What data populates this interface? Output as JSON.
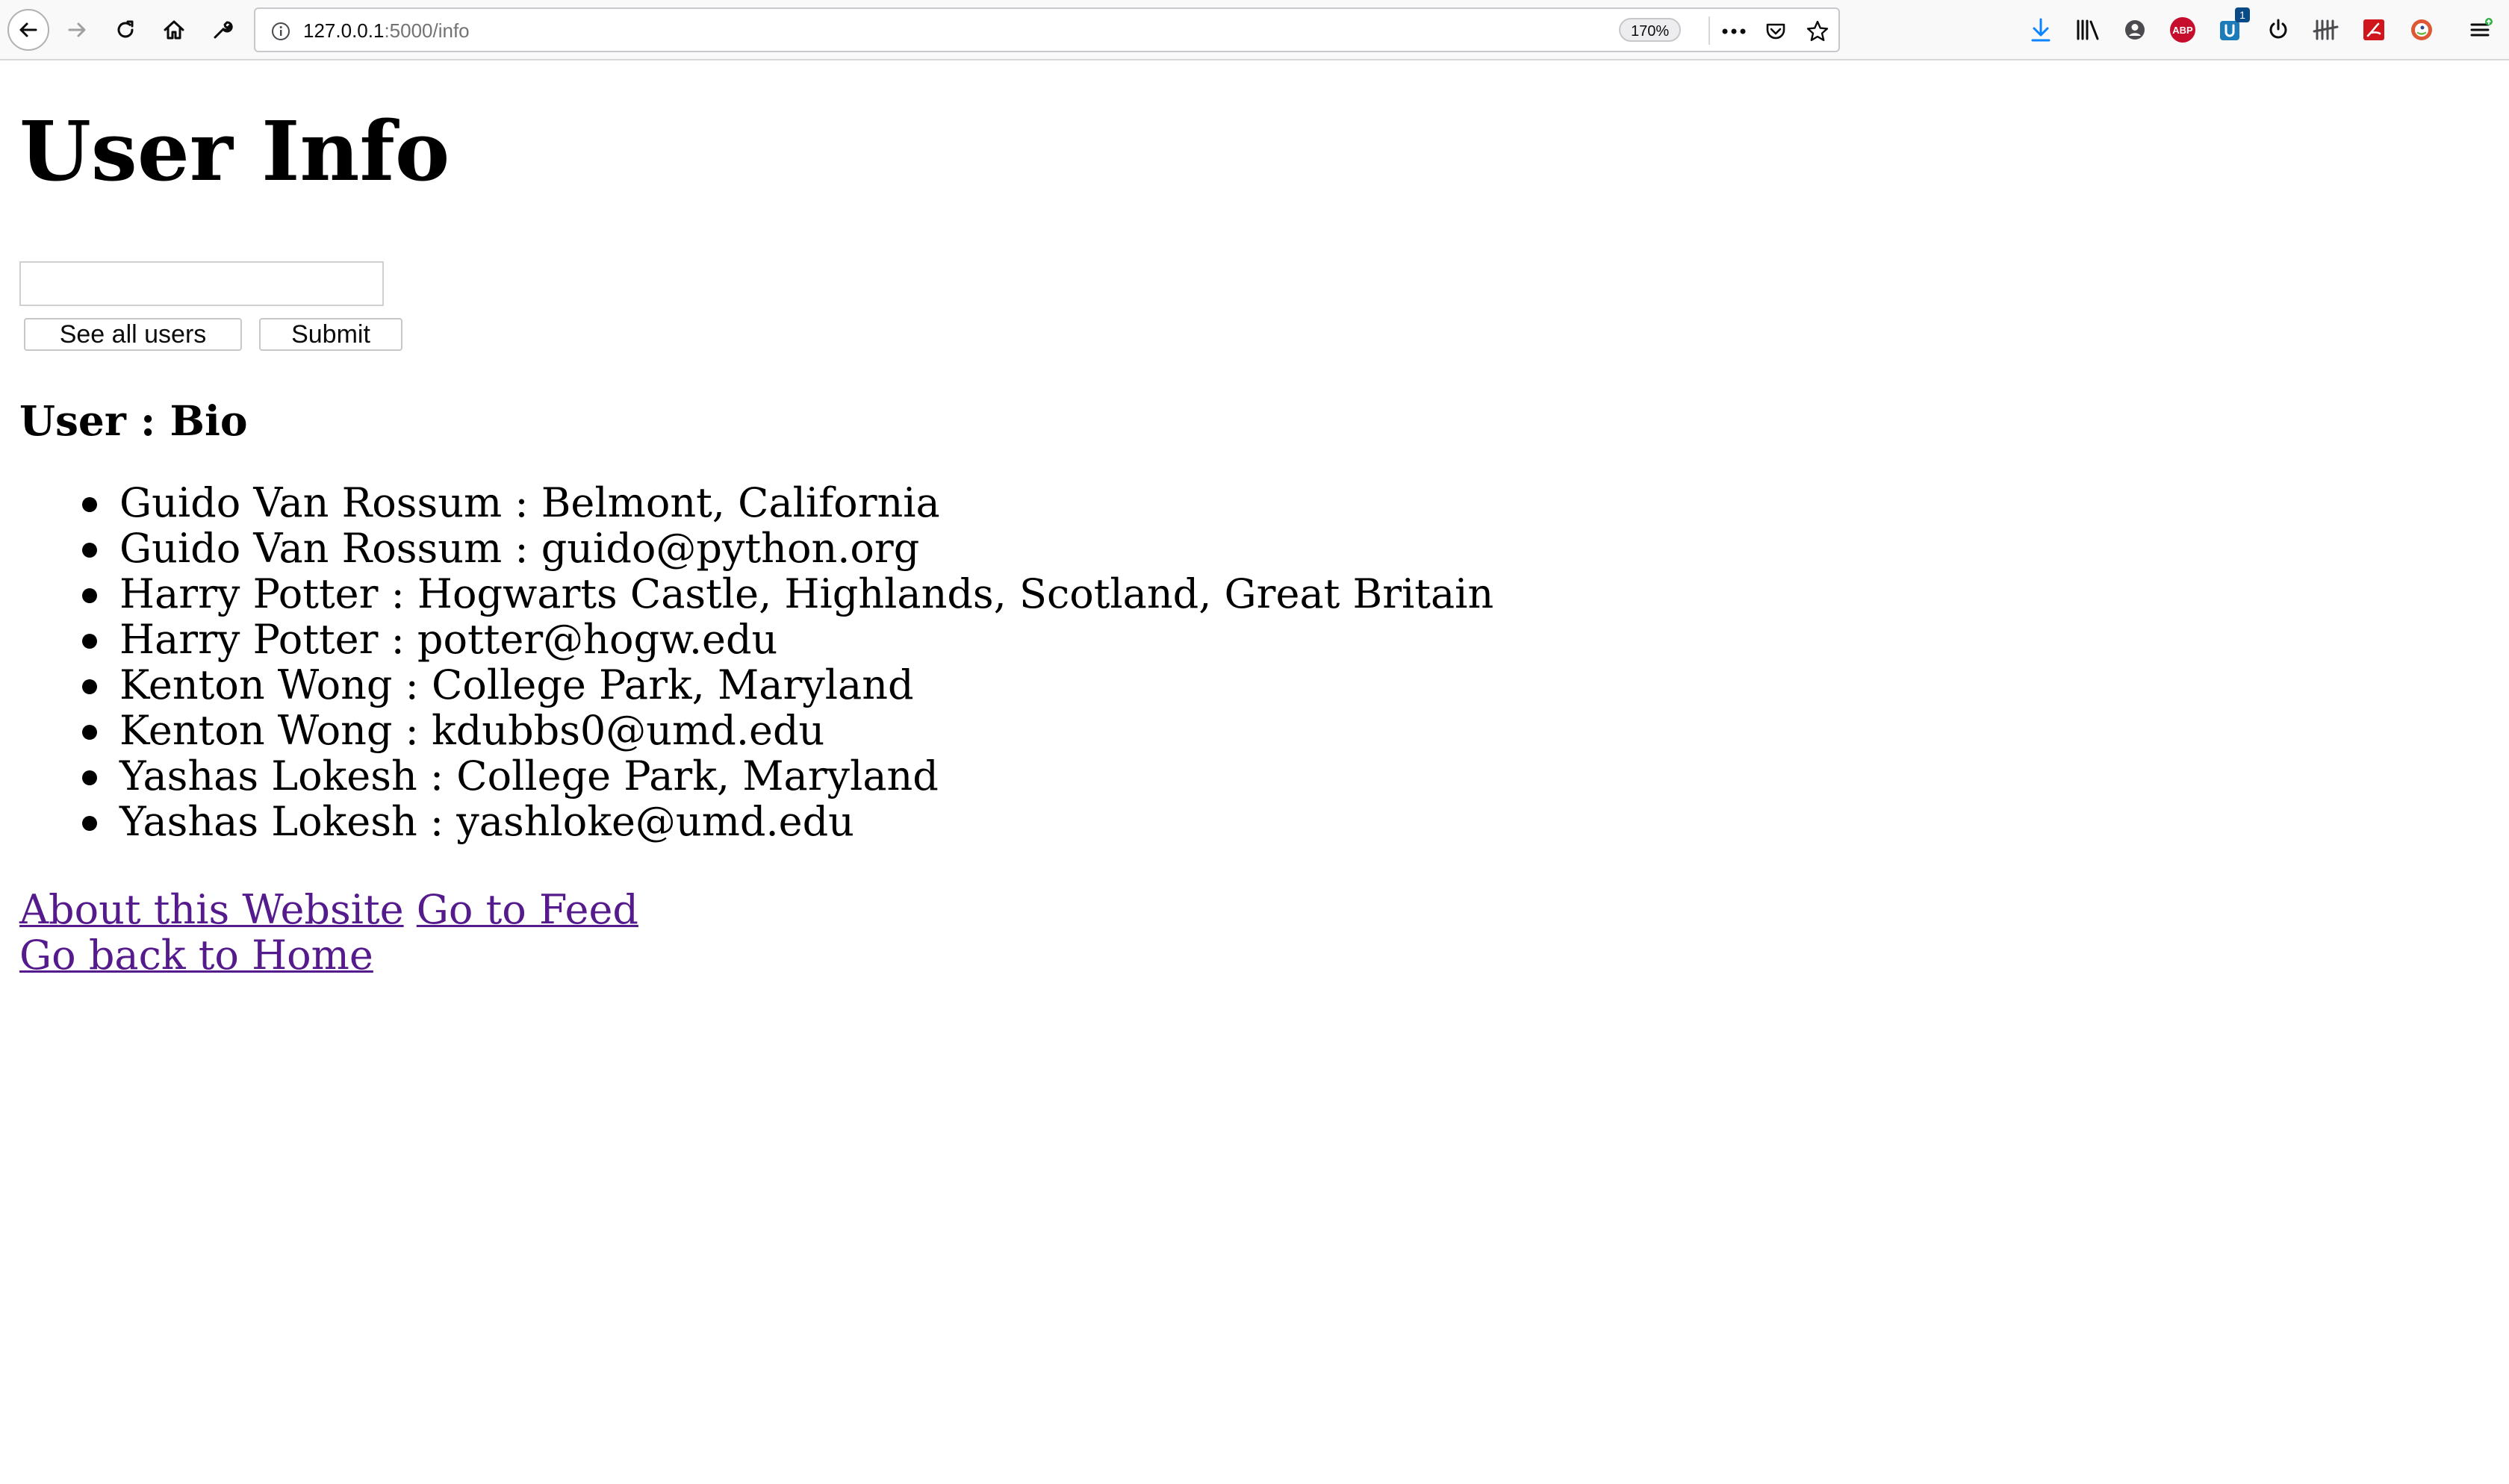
{
  "browser": {
    "url_host": "127.0.0.1",
    "url_path": ":5000/info",
    "zoom": "170%",
    "extension_badge": "1",
    "abp_label": "ABP"
  },
  "page": {
    "title": "User Info",
    "search": {
      "value": "",
      "placeholder": ""
    },
    "buttons": {
      "see_all": "See all users",
      "submit": "Submit"
    },
    "heading": "User : Bio",
    "bios": [
      "Guido Van Rossum : Belmont, California",
      "Guido Van Rossum : guido@python.org",
      "Harry Potter : Hogwarts Castle, Highlands, Scotland, Great Britain",
      "Harry Potter : potter@hogw.edu",
      "Kenton Wong : College Park, Maryland",
      "Kenton Wong : kdubbs0@umd.edu",
      "Yashas Lokesh : College Park, Maryland",
      "Yashas Lokesh : yashloke@umd.edu"
    ],
    "links": {
      "about": "About this Website",
      "feed": "Go to Feed",
      "home": "Go back to Home"
    }
  },
  "colors": {
    "link_visited": "#551a8b",
    "toolbar_bg": "#f9f9fa",
    "download_icon": "#0a84ff",
    "abp_red": "#c70d2c"
  },
  "icons": [
    "back-arrow-icon",
    "forward-arrow-icon",
    "reload-icon",
    "home-icon",
    "wrench-icon",
    "info-icon",
    "page-actions-icon",
    "pocket-icon",
    "bookmark-star-icon",
    "download-icon",
    "library-icon",
    "account-icon",
    "adblock-icon",
    "extension-icon",
    "power-icon",
    "tally-icon",
    "pdf-icon",
    "duckduckgo-icon",
    "menu-icon"
  ]
}
